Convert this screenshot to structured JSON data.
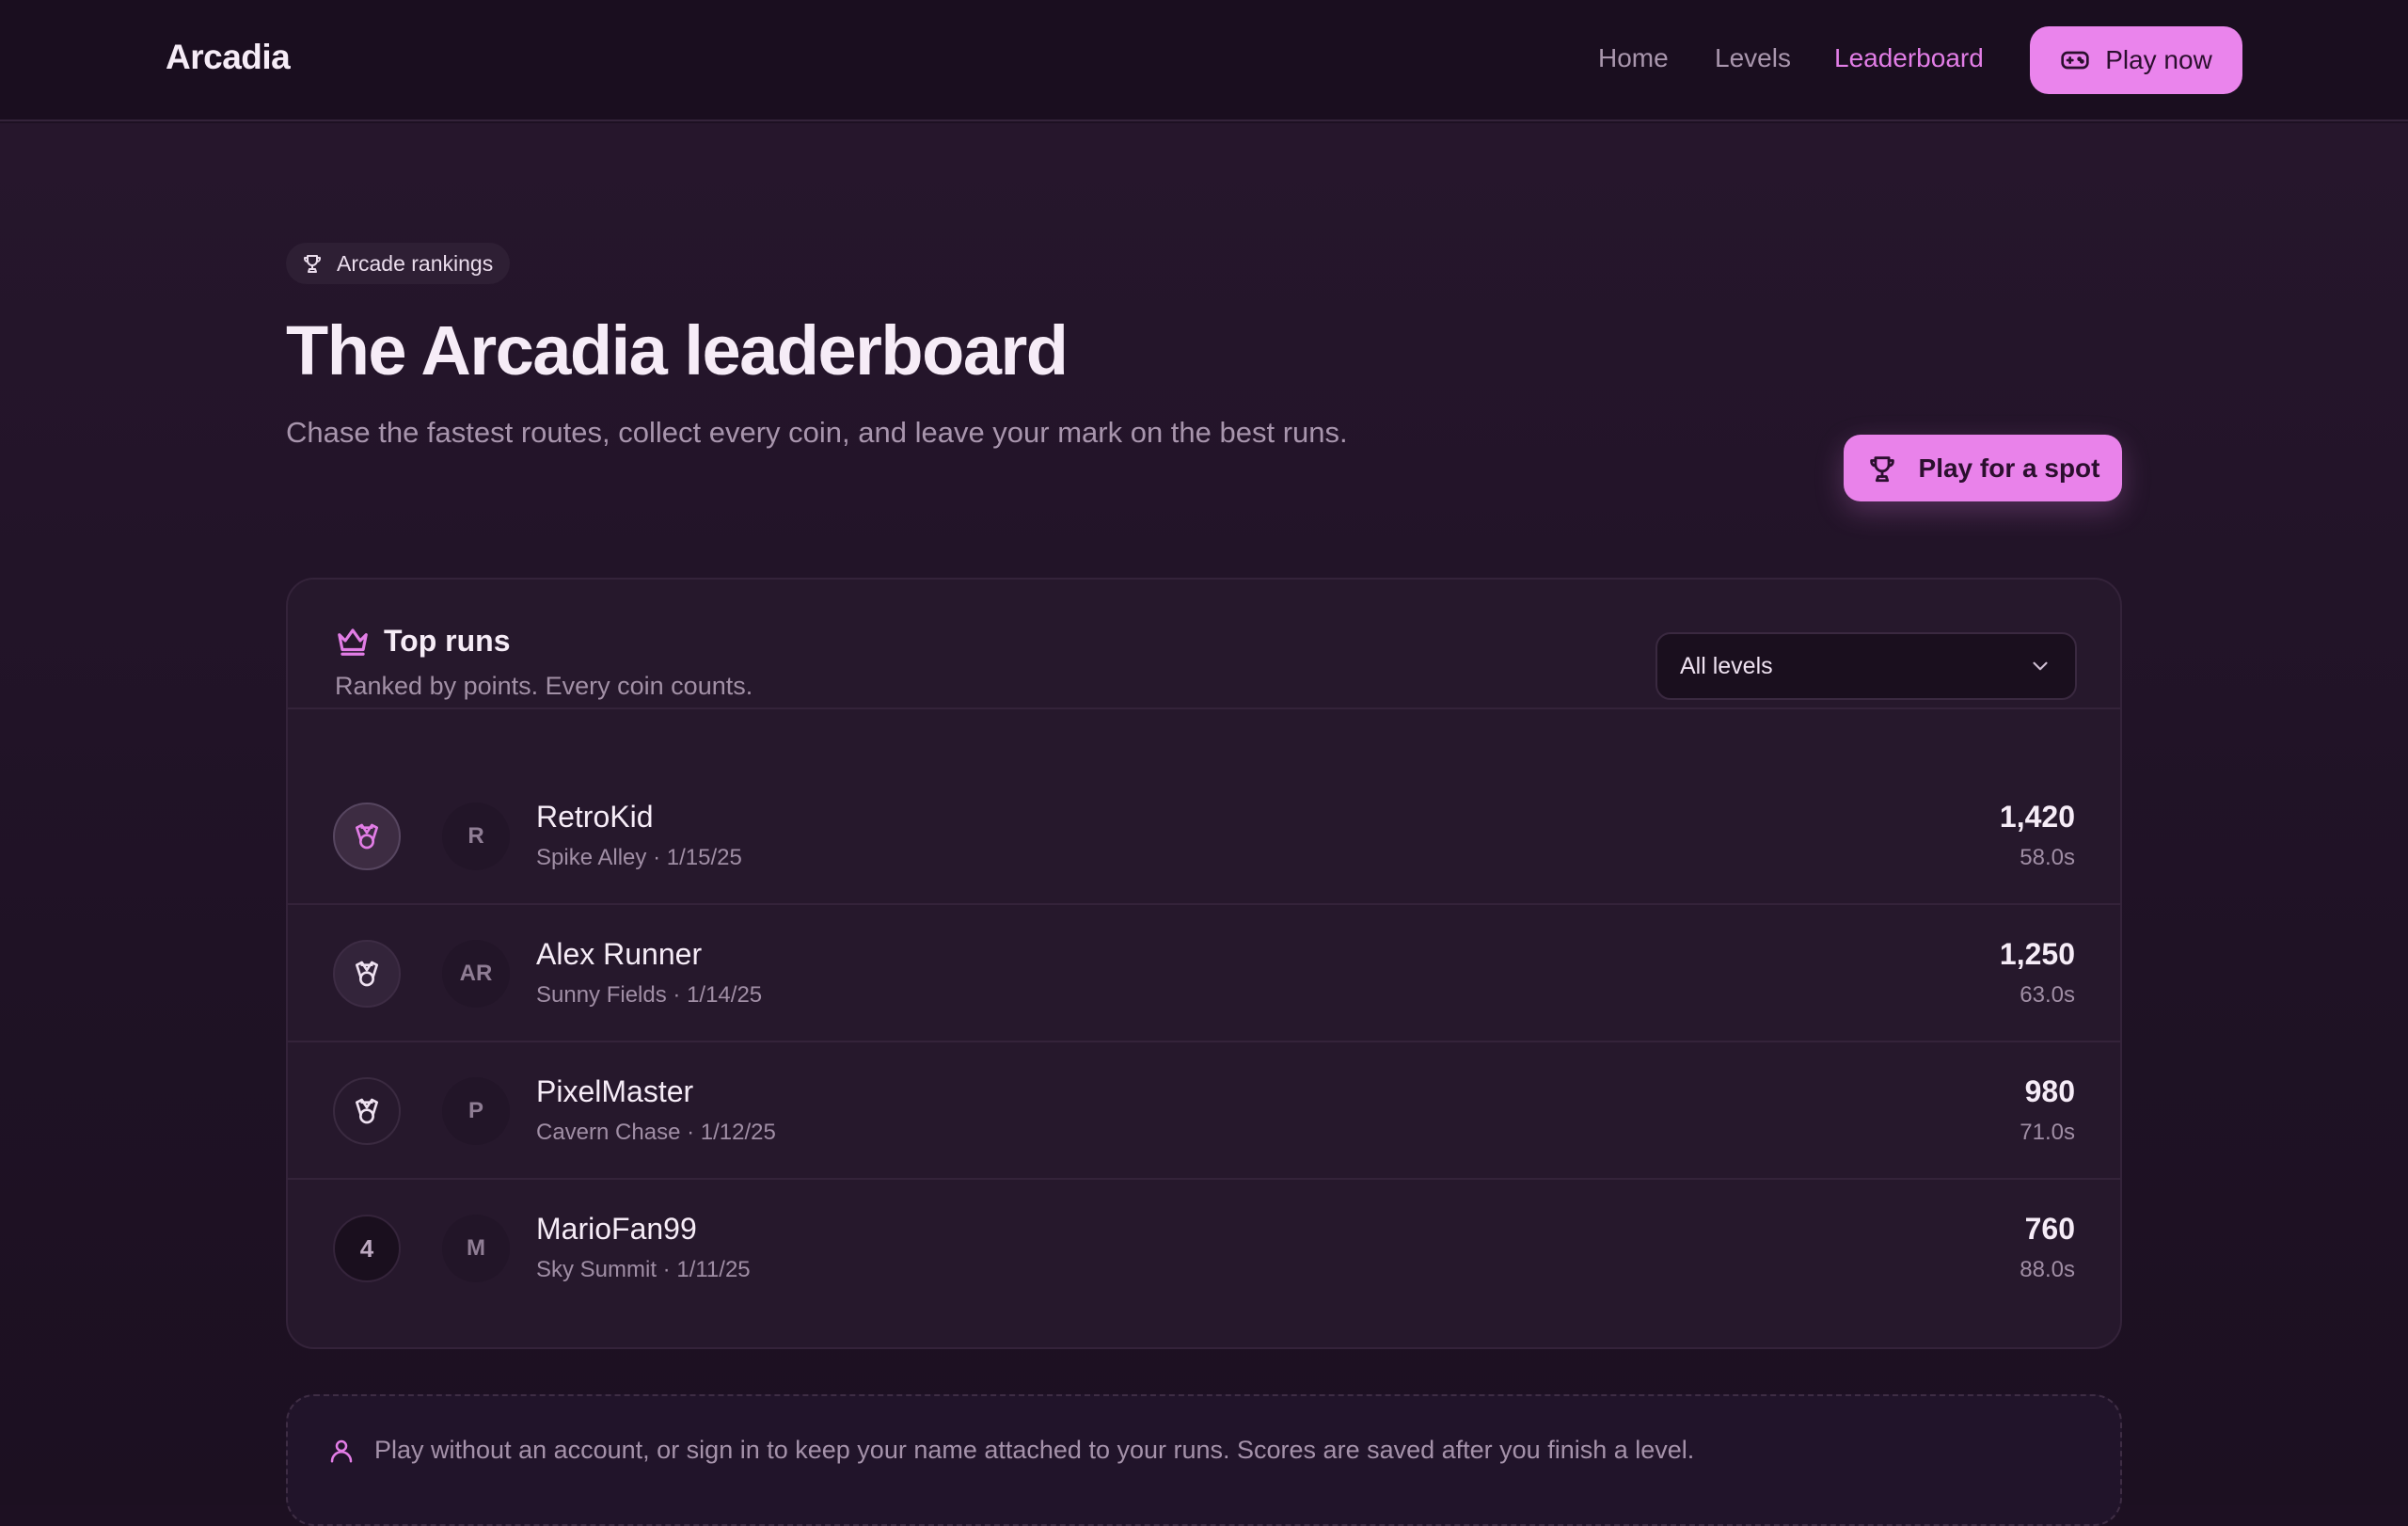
{
  "header": {
    "brand": "Arcadia",
    "nav": [
      {
        "label": "Home"
      },
      {
        "label": "Levels"
      },
      {
        "label": "Leaderboard",
        "active": true
      }
    ],
    "cta_label": "Play now"
  },
  "hero": {
    "chip_label": "Arcade rankings",
    "title": "The Arcadia leaderboard",
    "subtitle": "Chase the fastest routes, collect every coin, and leave your mark on the best runs.",
    "cta_label": "Play for a spot"
  },
  "leaderboard": {
    "title": "Top runs",
    "subtitle": "Ranked by points. Every coin counts.",
    "filter": {
      "selected": "All levels"
    },
    "rows": [
      {
        "rank": "1",
        "rank_icon": "medal-icon",
        "initials": "R",
        "name": "RetroKid",
        "meta": "Spike Alley · 1/15/25",
        "points": "1,420",
        "time": "58.0s"
      },
      {
        "rank": "2",
        "rank_icon": "medal-icon",
        "initials": "AR",
        "name": "Alex Runner",
        "meta": "Sunny Fields · 1/14/25",
        "points": "1,250",
        "time": "63.0s"
      },
      {
        "rank": "3",
        "rank_icon": "medal-icon",
        "initials": "P",
        "name": "PixelMaster",
        "meta": "Cavern Chase · 1/12/25",
        "points": "980",
        "time": "71.0s"
      },
      {
        "rank": "4",
        "rank_icon": null,
        "initials": "M",
        "name": "MarioFan99",
        "meta": "Sky Summit · 1/11/25",
        "points": "760",
        "time": "88.0s"
      }
    ]
  },
  "notice": {
    "icon": "user-icon",
    "text": "Play without an account, or sign in to keep your name attached to your runs. Scores are saved after you finish a level."
  },
  "colors": {
    "accent": "#ea84ec",
    "background": "#1d1022",
    "card": "#26182c",
    "muted_text": "#a895ad"
  }
}
